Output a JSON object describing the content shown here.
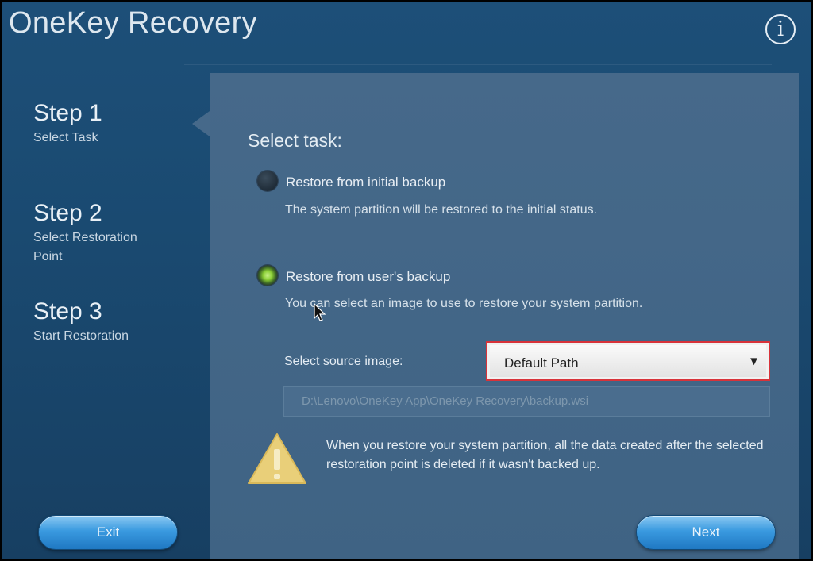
{
  "app": {
    "title": "OneKey Recovery"
  },
  "icons": {
    "info": "info-icon",
    "warning": "warning-icon",
    "dropdown": "chevron-down-icon",
    "cursor": "mouse-cursor-icon"
  },
  "steps": [
    {
      "title": "Step 1",
      "subtitle": "Select Task"
    },
    {
      "title": "Step 2",
      "subtitle": "Select Restoration Point"
    },
    {
      "title": "Step 3",
      "subtitle": "Start Restoration"
    }
  ],
  "task": {
    "heading": "Select task:",
    "options": [
      {
        "label": "Restore from initial backup",
        "description": "The system partition will be restored to the initial status.",
        "checked": false
      },
      {
        "label": "Restore from user's backup",
        "description": "You can select an image to use to restore your system partition.",
        "checked": true
      }
    ]
  },
  "source": {
    "label": "Select source image:",
    "selected": "Default Path",
    "path": "D:\\Lenovo\\OneKey App\\OneKey Recovery\\backup.wsi"
  },
  "warning": {
    "text": "When you restore your system partition, all the data created after the selected restoration point is deleted if it wasn't backed up."
  },
  "buttons": {
    "exit": "Exit",
    "next": "Next"
  },
  "colors": {
    "accent_radio": "#8bcf35",
    "highlight_border": "#d8333a",
    "button_blue": "#3a9ae0"
  }
}
